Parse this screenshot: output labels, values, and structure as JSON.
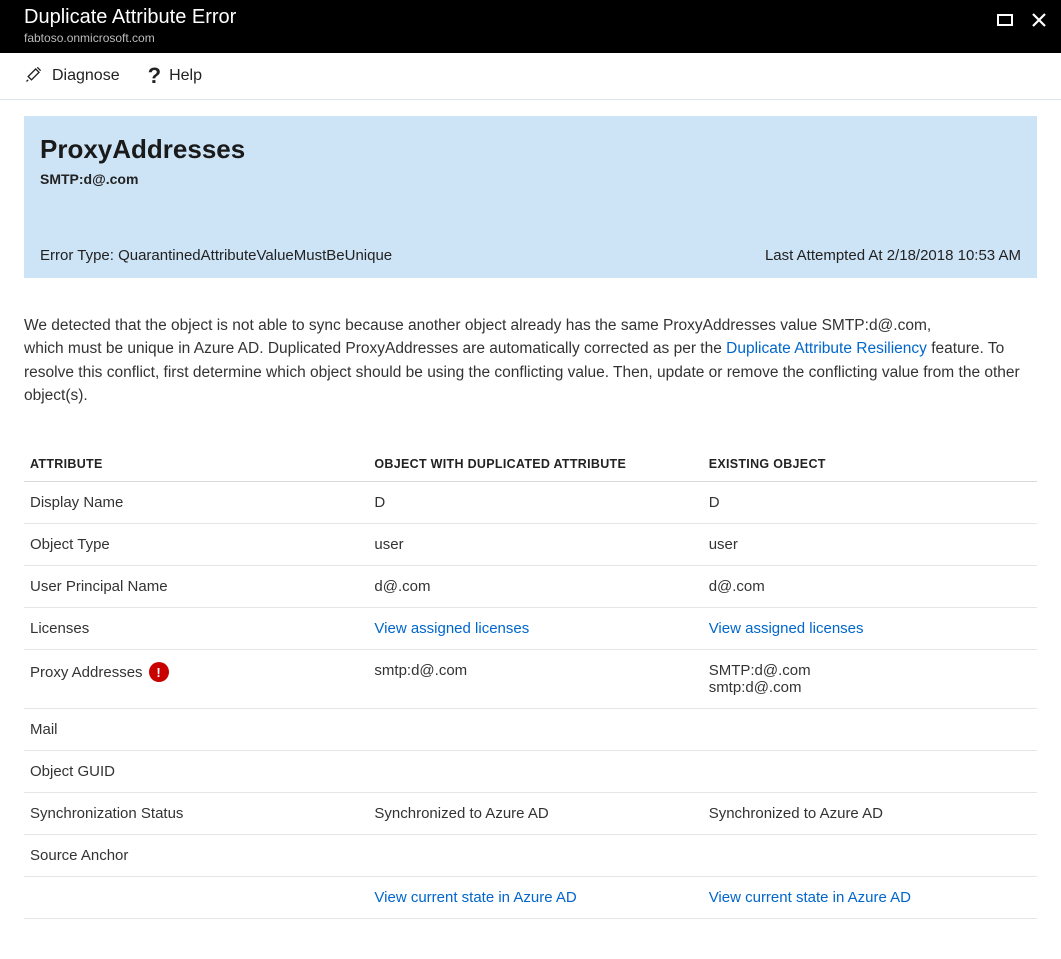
{
  "titlebar": {
    "title": "Duplicate Attribute Error",
    "subtitle": "fabtoso.onmicrosoft.com"
  },
  "toolbar": {
    "diagnose": "Diagnose",
    "help": "Help"
  },
  "banner": {
    "title": "ProxyAddresses",
    "subtitle": "SMTP:d@.com",
    "error_type_label": "Error Type: QuarantinedAttributeValueMustBeUnique",
    "last_attempted": "Last Attempted At 2/18/2018 10:53 AM"
  },
  "description": {
    "part1": "We detected that the object is not able to sync because another object already has the same ProxyAddresses value SMTP:d@.com,",
    "part2": "which must be unique in Azure AD. Duplicated ProxyAddresses are automatically corrected as per the ",
    "link": "Duplicate Attribute Resiliency",
    "part3": " feature. To resolve this conflict, first determine which object should be using the conflicting value. Then, update or remove the conflicting value from the other object(s)."
  },
  "table": {
    "headers": {
      "attribute": "ATTRIBUTE",
      "dup": "OBJECT WITH DUPLICATED ATTRIBUTE",
      "existing": "EXISTING OBJECT"
    },
    "rows": {
      "display_name": {
        "label": "Display Name",
        "dup": "D",
        "existing": "D"
      },
      "object_type": {
        "label": "Object Type",
        "dup": "user",
        "existing": "user"
      },
      "upn": {
        "label": "User Principal Name",
        "dup": "d@.com",
        "existing": "d@.com"
      },
      "licenses": {
        "label": "Licenses",
        "dup": "View assigned licenses",
        "existing": "View assigned licenses"
      },
      "proxy": {
        "label": "Proxy Addresses",
        "dup": "smtp:d@.com",
        "existing_line1": "SMTP:d@.com",
        "existing_line2": "smtp:d@.com"
      },
      "mail": {
        "label": "Mail",
        "dup": "",
        "existing": ""
      },
      "guid": {
        "label": "Object GUID",
        "dup": "",
        "existing": ""
      },
      "sync": {
        "label": "Synchronization Status",
        "dup": "Synchronized to Azure AD",
        "existing": "Synchronized to Azure AD"
      },
      "anchor": {
        "label": "Source Anchor",
        "dup": "",
        "existing": ""
      },
      "footer": {
        "label": "",
        "dup": "View current state in Azure AD",
        "existing": "View current state in Azure AD"
      }
    }
  }
}
